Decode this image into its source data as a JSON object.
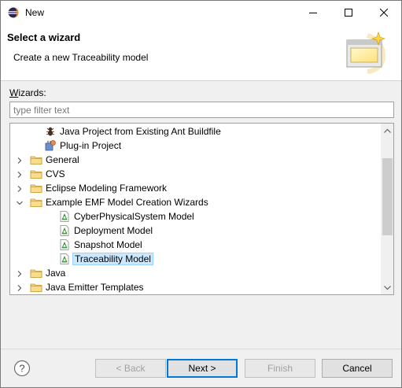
{
  "window": {
    "title": "New",
    "icon": "eclipse-icon"
  },
  "header": {
    "title": "Select a wizard",
    "description": "Create a new Traceability model",
    "image": "wizard-banner-icon"
  },
  "wizards_label_underlined": "W",
  "wizards_label_rest": "izards:",
  "filter": {
    "placeholder": "type filter text",
    "value": ""
  },
  "tree": {
    "items": [
      {
        "label": "Java Project from Existing Ant Buildfile",
        "icon": "ant-project-icon",
        "indent": 1,
        "expander": "none",
        "selected": false
      },
      {
        "label": "Plug-in Project",
        "icon": "plugin-project-icon",
        "indent": 1,
        "expander": "none",
        "selected": false
      },
      {
        "label": "General",
        "icon": "folder-icon",
        "indent": 0,
        "expander": "collapsed",
        "selected": false
      },
      {
        "label": "CVS",
        "icon": "folder-icon",
        "indent": 0,
        "expander": "collapsed",
        "selected": false
      },
      {
        "label": "Eclipse Modeling Framework",
        "icon": "folder-icon",
        "indent": 0,
        "expander": "collapsed",
        "selected": false
      },
      {
        "label": "Example EMF Model Creation Wizards",
        "icon": "folder-icon",
        "indent": 0,
        "expander": "expanded",
        "selected": false
      },
      {
        "label": "CyberPhysicalSystem Model",
        "icon": "model-icon",
        "indent": 2,
        "expander": "none",
        "selected": false
      },
      {
        "label": "Deployment Model",
        "icon": "model-icon",
        "indent": 2,
        "expander": "none",
        "selected": false
      },
      {
        "label": "Snapshot Model",
        "icon": "model-icon",
        "indent": 2,
        "expander": "none",
        "selected": false
      },
      {
        "label": "Traceability Model",
        "icon": "model-icon",
        "indent": 2,
        "expander": "none",
        "selected": true
      },
      {
        "label": "Java",
        "icon": "folder-icon",
        "indent": 0,
        "expander": "collapsed",
        "selected": false
      },
      {
        "label": "Java Emitter Templates",
        "icon": "folder-icon",
        "indent": 0,
        "expander": "collapsed",
        "selected": false
      }
    ]
  },
  "buttons": {
    "back": "< Back",
    "next": "Next >",
    "finish": "Finish",
    "cancel": "Cancel"
  },
  "colors": {
    "selection": "#cce8ff",
    "accent": "#0078d7"
  }
}
